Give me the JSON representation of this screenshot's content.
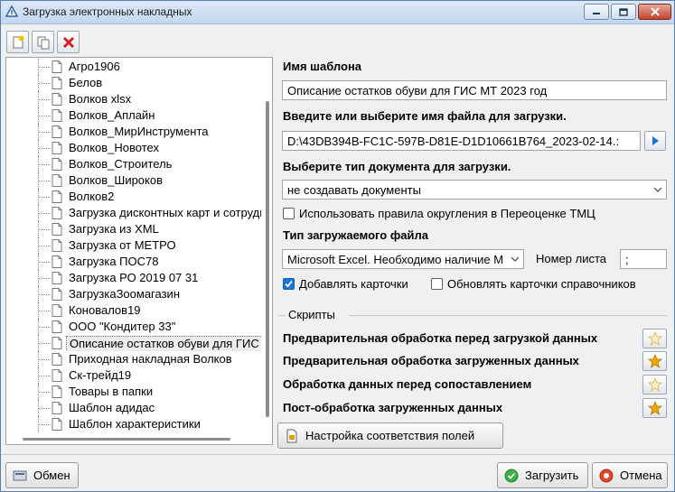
{
  "window": {
    "title": "Загрузка электронных накладных"
  },
  "tree": {
    "items": [
      "Агро1906",
      "Белов",
      "Волков xlsx",
      "Волков_Аплайн",
      "Волков_МирИнструмента",
      "Волков_Новотех",
      "Волков_Строитель",
      "Волков_Широков",
      "Волков2",
      "Загрузка дисконтных карт и сотрудник",
      "Загрузка из XML",
      "Загрузка от МЕТРО",
      "Загрузка ПОС78",
      "Загрузка РО 2019 07 31",
      "ЗагрузкаЗоомагазин",
      "Коновалов19",
      "ООО \"Кондитер 33\"",
      "Описание остатков обуви для ГИС МТ",
      "Приходная накладная Волков",
      "Ск-трейд19",
      "Товары в папки",
      "Шаблон адидас",
      "Шаблон характеристики"
    ],
    "selected_index": 17
  },
  "form": {
    "template_name_label": "Имя шаблона",
    "template_name_value": "Описание остатков обуви для ГИС МТ 2023 год",
    "file_label": "Введите или выберите имя файла для загрузки.",
    "file_value": "D:\\43DB394B-FC1C-597B-D81E-D1D10661B764_2023-02-14.:",
    "doc_type_label": "Выберите тип документа для загрузки.",
    "doc_type_value": "не создавать документы",
    "rounding_label": "Использовать правила округления в Переоценке ТМЦ",
    "rounding_checked": false,
    "file_type_label": "Тип загружаемого файла",
    "file_type_value": "Microsoft Excel. Необходимо наличие M",
    "sheet_label": "Номер листа",
    "sheet_value": ";",
    "add_cards_label": "Добавлять карточки",
    "add_cards_checked": true,
    "update_cards_label": "Обновлять карточки справочников",
    "update_cards_checked": false
  },
  "scripts": {
    "section_title": "Скрипты",
    "items": [
      {
        "label": "Предварительная обработка  перед загрузкой данных",
        "active": false
      },
      {
        "label": "Предварительная обработка загруженных данных",
        "active": true
      },
      {
        "label": "Обработка данных перед сопоставлением",
        "active": false
      },
      {
        "label": "Пост-обработка загруженных данных",
        "active": true
      }
    ]
  },
  "buttons": {
    "mapping": "Настройка соответствия полей",
    "exchange": "Обмен",
    "load": "Загрузить",
    "cancel": "Отмена"
  },
  "colors": {
    "accent": "#1a73d9",
    "star_active": "#f0a800",
    "star_inactive": "#f7e6a8"
  }
}
